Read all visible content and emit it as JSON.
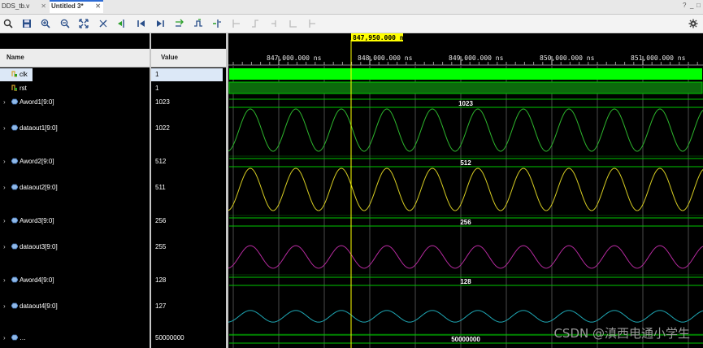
{
  "tabs": [
    {
      "label": "DDS_tb.v",
      "active": false
    },
    {
      "label": "Untitled 3*",
      "active": true
    }
  ],
  "tab_controls": {
    "help": "?",
    "minimize": "_",
    "maximize": "□"
  },
  "toolbar": {
    "icons": [
      "search-icon",
      "save-icon",
      "zoom-in-icon",
      "zoom-out-icon",
      "zoom-fit-icon",
      "cursor-to-zero-icon",
      "go-to-time-zero-icon",
      "go-to-first-icon",
      "go-to-last-icon",
      "swap-cursors-icon",
      "add-marker-icon",
      "previous-marker-icon",
      "next-marker-icon",
      "previous-transition-icon",
      "next-transition-icon",
      "snap-to-transition-icon",
      "add-group-icon",
      "settings-icon"
    ]
  },
  "columns": {
    "name": "Name",
    "value": "Value"
  },
  "signals": [
    {
      "name": "clk",
      "value": "1",
      "expandable": false,
      "icon": "bit"
    },
    {
      "name": "rst",
      "value": "1",
      "expandable": false,
      "icon": "bit"
    },
    {
      "name": "Aword1[9:0]",
      "value": "1023",
      "expandable": true,
      "icon": "bus"
    },
    {
      "name": "dataout1[9:0]",
      "value": "1022",
      "expandable": true,
      "icon": "bus"
    },
    {
      "name": "Aword2[9:0]",
      "value": "512",
      "expandable": true,
      "icon": "bus"
    },
    {
      "name": "dataout2[9:0]",
      "value": "511",
      "expandable": true,
      "icon": "bus"
    },
    {
      "name": "Aword3[9:0]",
      "value": "256",
      "expandable": true,
      "icon": "bus"
    },
    {
      "name": "dataout3[9:0]",
      "value": "255",
      "expandable": true,
      "icon": "bus"
    },
    {
      "name": "Aword4[9:0]",
      "value": "128",
      "expandable": true,
      "icon": "bus"
    },
    {
      "name": "dataout4[9:0]",
      "value": "127",
      "expandable": true,
      "icon": "bus"
    },
    {
      "name": "…",
      "value": "50000000",
      "expandable": true,
      "icon": "bus"
    }
  ],
  "timeline": {
    "cursor_label": "847,950.000 ns",
    "ticks": [
      "847,000.000 ns",
      "848,000.000 ns",
      "849,000.000 ns",
      "850,000.000 ns",
      "851,000.000 ns"
    ],
    "unit": "ns"
  },
  "bus_labels": [
    "1023",
    "512",
    "256",
    "128",
    "50000000"
  ],
  "colors": {
    "clk": "#00ff00",
    "bus": "#00c800",
    "wave1": "#2db52d",
    "wave2": "#d6cc22",
    "wave3": "#b52a9e",
    "wave4": "#1fa8b5",
    "cursor": "#ffff00",
    "grid": "#4a4a4a"
  },
  "watermark": "CSDN @滇西电通小学生"
}
